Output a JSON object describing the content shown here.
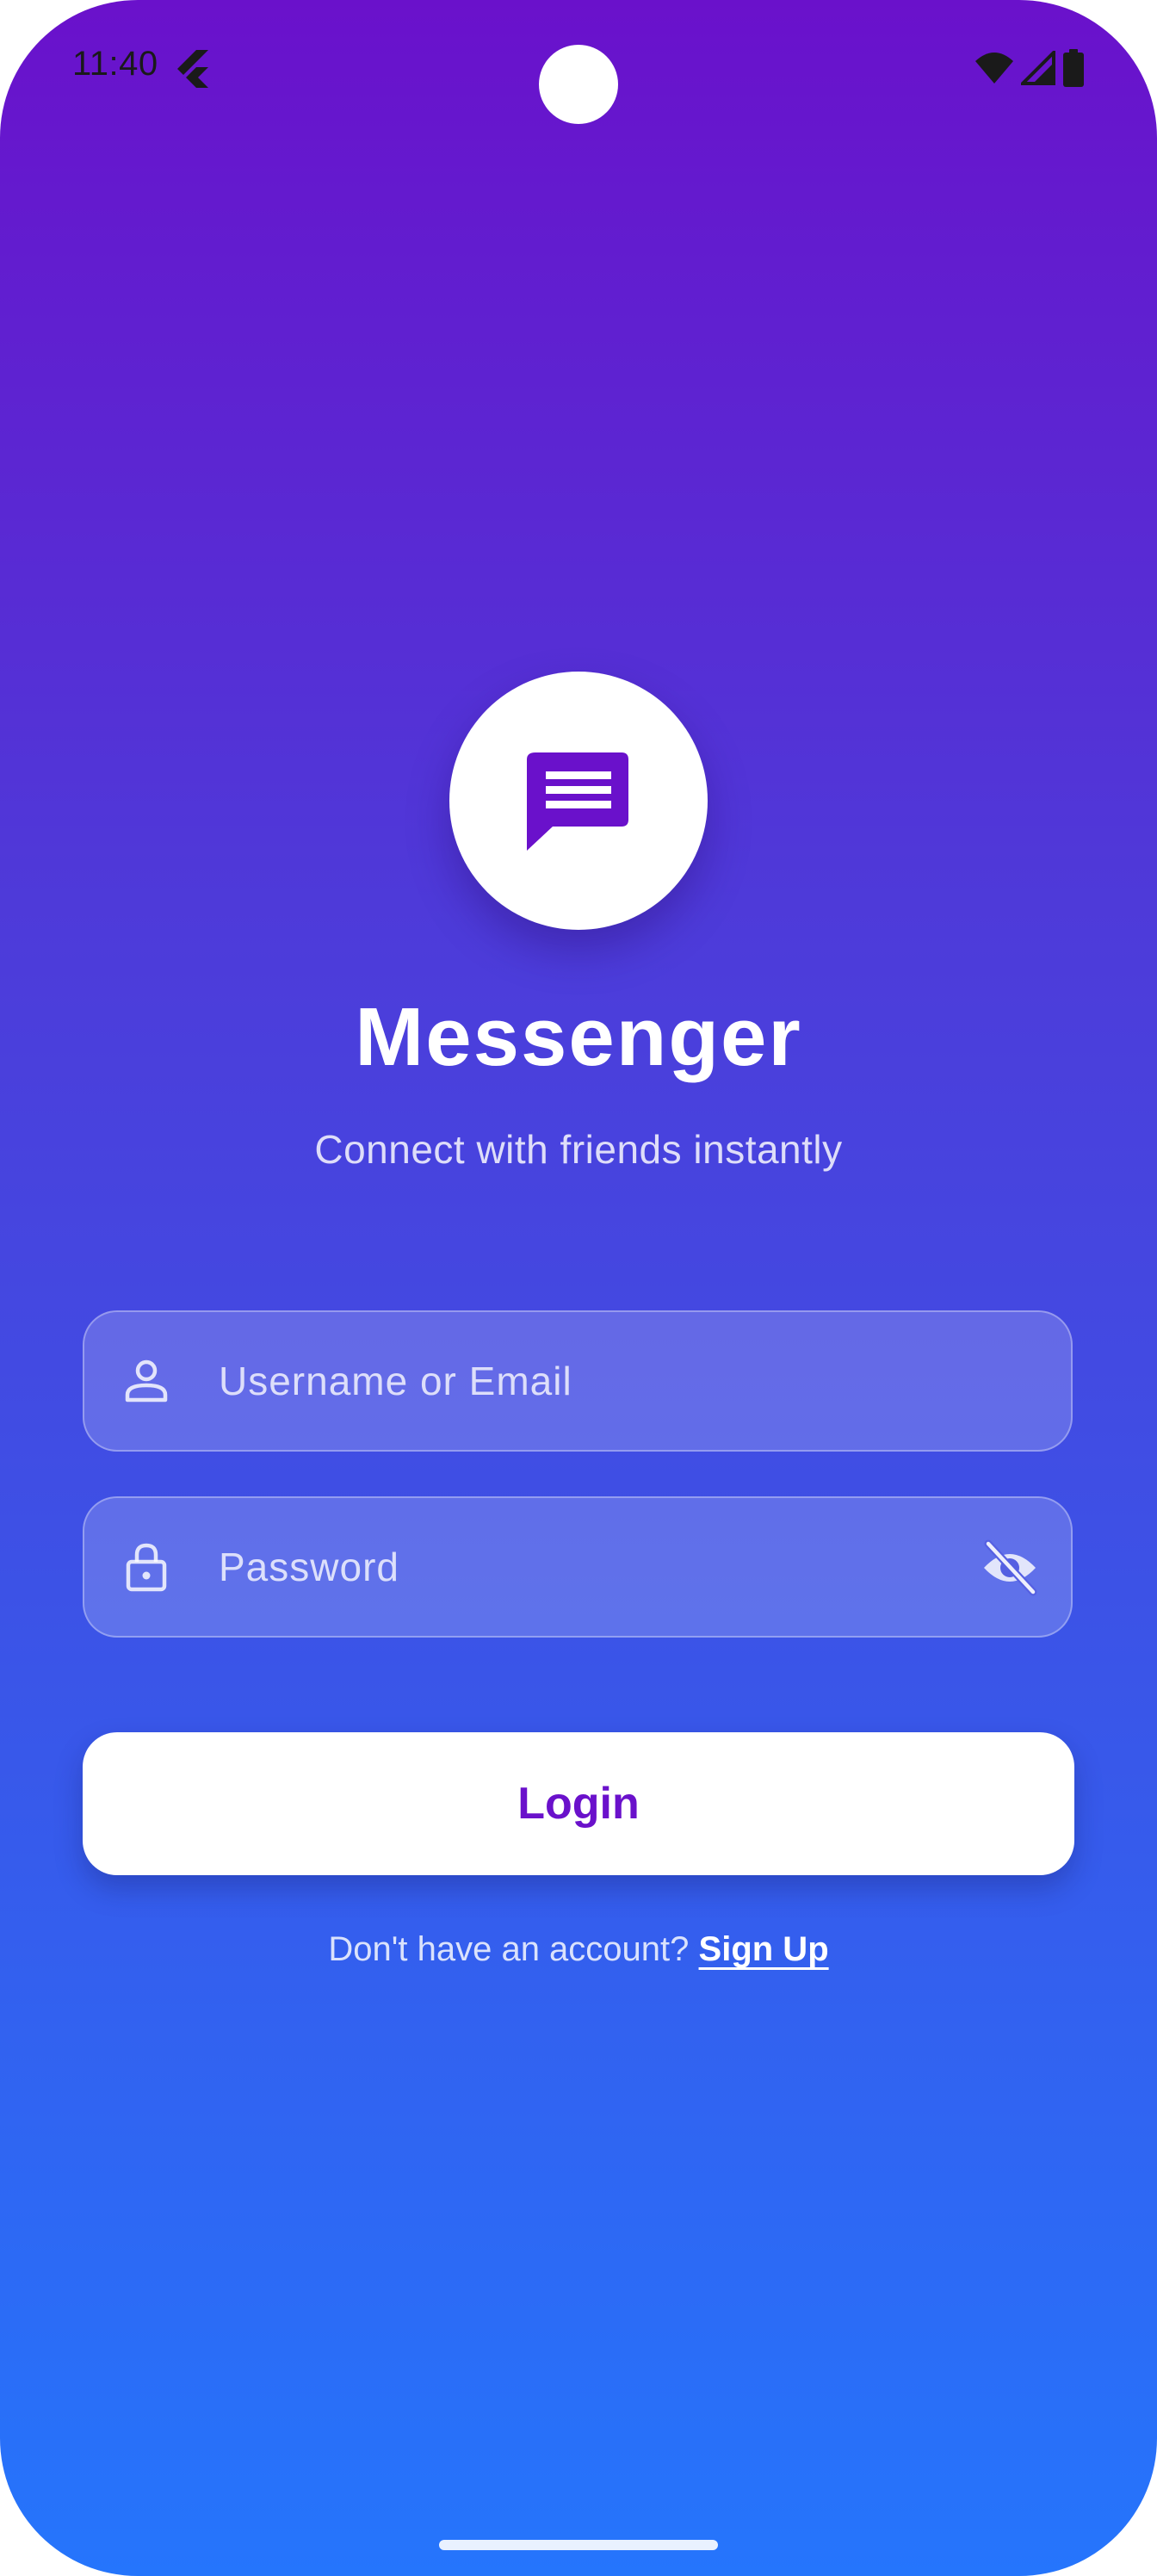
{
  "status_bar": {
    "time": "11:40",
    "icons": [
      "flutter-icon",
      "wifi-icon",
      "cellular-signal-icon",
      "battery-icon"
    ]
  },
  "logo": {
    "icon": "chat-bubble-icon",
    "icon_color": "#6a11cb"
  },
  "app": {
    "title": "Messenger",
    "subtitle": "Connect with friends instantly"
  },
  "form": {
    "username": {
      "placeholder": "Username or Email",
      "value": "",
      "icon": "person-icon"
    },
    "password": {
      "placeholder": "Password",
      "value": "",
      "icon": "lock-icon",
      "toggle_icon": "visibility-off-icon"
    },
    "login_label": "Login"
  },
  "signup": {
    "prompt": "Don't have an account?",
    "link_label": "Sign Up"
  },
  "colors": {
    "gradient_top": "#6a11cb",
    "gradient_bottom": "#2575fc",
    "accent": "#6a11cb",
    "button_bg": "#ffffff"
  }
}
